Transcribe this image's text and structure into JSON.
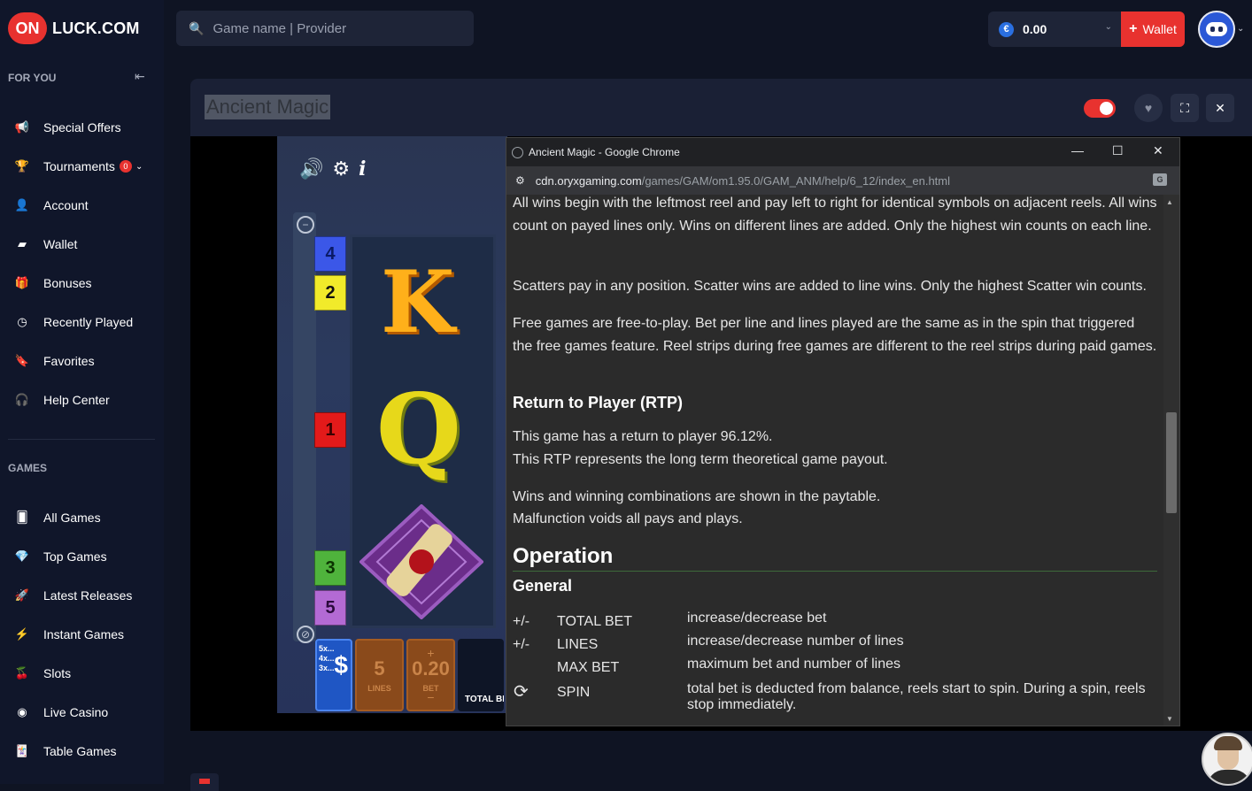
{
  "brand": {
    "on": "ON",
    "name": "LUCK.COM"
  },
  "search": {
    "placeholder": "Game name | Provider"
  },
  "balance": {
    "currency_symbol": "€",
    "amount": "0.00"
  },
  "wallet_button": {
    "label": "Wallet"
  },
  "sidebar": {
    "for_you_heading": "FOR YOU",
    "for_you_items": [
      {
        "label": "Special Offers",
        "icon": "megaphone-icon"
      },
      {
        "label": "Tournaments",
        "icon": "trophy-icon",
        "badge": "0"
      },
      {
        "label": "Account",
        "icon": "user-icon"
      },
      {
        "label": "Wallet",
        "icon": "wallet-icon"
      },
      {
        "label": "Bonuses",
        "icon": "gift-icon"
      },
      {
        "label": "Recently Played",
        "icon": "clock-icon"
      },
      {
        "label": "Favorites",
        "icon": "bookmark-icon"
      },
      {
        "label": "Help Center",
        "icon": "headset-icon"
      }
    ],
    "games_heading": "GAMES",
    "games_items": [
      {
        "label": "All Games",
        "icon": "cards-icon"
      },
      {
        "label": "Top Games",
        "icon": "diamond-icon"
      },
      {
        "label": "Latest Releases",
        "icon": "rocket-icon"
      },
      {
        "label": "Instant Games",
        "icon": "lightning-icon"
      },
      {
        "label": "Slots",
        "icon": "cherries-icon"
      },
      {
        "label": "Live Casino",
        "icon": "roulette-icon"
      },
      {
        "label": "Table Games",
        "icon": "card-icon"
      }
    ]
  },
  "game": {
    "title": "Ancient Magic",
    "line_markers": [
      "4",
      "2",
      "1",
      "3",
      "5"
    ],
    "paytable_text": [
      "5x...",
      "4x...",
      "3x..."
    ],
    "lines_value": "5",
    "lines_label": "LINES",
    "bet_value": "0.20",
    "bet_label": "BET",
    "total_label": "TOTAL BET"
  },
  "chrome": {
    "window_title": "Ancient Magic - Google Chrome",
    "url_host": "cdn.oryxgaming.com",
    "url_path": "/games/GAM/om1.95.0/GAM_ANM/help/6_12/index_en.html",
    "p1": "All wins begin with the leftmost reel and pay left to right for identical symbols on adjacent reels. All wins count on payed lines only. Wins on different lines are added. Only the highest win counts on each line.",
    "p2": "Scatters pay in any position. Scatter wins are added to line wins. Only the highest Scatter win counts.",
    "p3": "Free games are free-to-play. Bet per line and lines played are the same as in the spin that triggered the free games feature. Reel strips during free games are different to the reel strips during paid games.",
    "rtp_heading": "Return to Player (RTP)",
    "rtp_line1": "This game has a return to player 96.12%.",
    "rtp_line2": "This RTP represents the long term theoretical game payout.",
    "wins_line1": "Wins and winning combinations are shown in the paytable.",
    "wins_line2": "Malfunction voids all pays and plays.",
    "operation_heading": "Operation",
    "general_heading": "General",
    "ops": [
      {
        "sign": "+/-",
        "name": "TOTAL BET",
        "desc": "increase/decrease bet"
      },
      {
        "sign": "+/-",
        "name": "LINES",
        "desc": "increase/decrease number of lines"
      },
      {
        "sign": "",
        "name": "MAX BET",
        "desc": "maximum bet and number of lines"
      },
      {
        "sign": "",
        "name": "SPIN",
        "desc": "total bet is deducted from balance, reels start to spin. During a spin, reels stop immediately."
      }
    ]
  }
}
